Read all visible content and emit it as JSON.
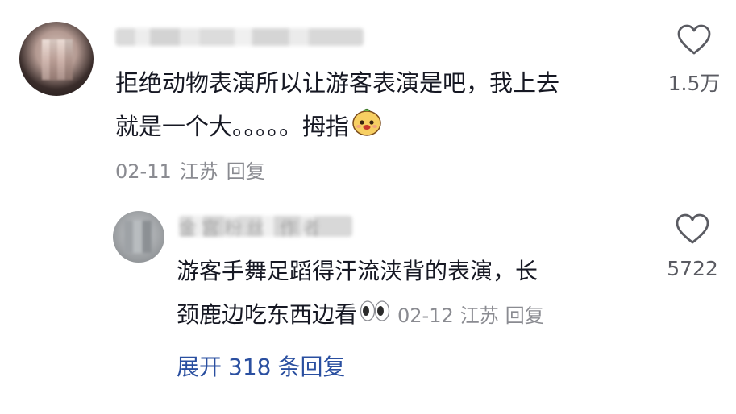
{
  "comment": {
    "line1": "拒绝动物表演所以让游客表演是吧，我上去",
    "line2": "就是一个大。。。。。拇指",
    "date": "02-11",
    "location": "江苏",
    "reply_label": "回复",
    "like_count": "1.5万",
    "emoji_icon": "smile-bun-emoji-icon"
  },
  "reply": {
    "username_blurred": "金宫粉丝",
    "badge_blurred": "作者",
    "line1": "游客手舞足蹈得汗流浃背的表演，长",
    "line2": "颈鹿边吃东西边看",
    "date": "02-12",
    "location": "江苏",
    "reply_label": "回复",
    "like_count": "5722",
    "emoji_icon": "eyes-emoji-icon"
  },
  "expand": {
    "prefix": "展开",
    "count": "318",
    "suffix": "条回复"
  },
  "colors": {
    "text": "#161823",
    "meta": "#8a8b91",
    "link": "#2a4fa0"
  }
}
